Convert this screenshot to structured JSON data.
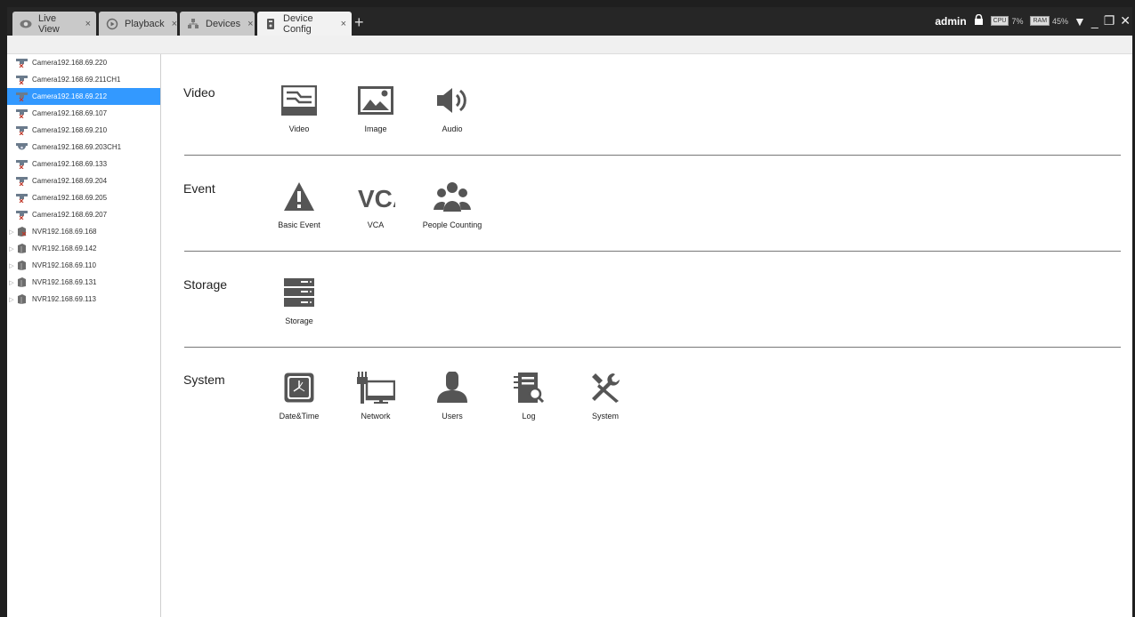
{
  "tabs": [
    {
      "label": "Live View",
      "icon": "eye-icon",
      "active": false
    },
    {
      "label": "Playback",
      "icon": "playback-icon",
      "active": false
    },
    {
      "label": "Devices",
      "icon": "devices-icon",
      "active": false
    },
    {
      "label": "Device Config",
      "icon": "device-config-icon",
      "active": true
    }
  ],
  "tab_close": "×",
  "new_tab": "+",
  "status": {
    "user": "admin",
    "cpu_label": "CPU",
    "cpu": "7%",
    "ram_label": "RAM",
    "ram": "45%"
  },
  "window": {
    "menu": "▼",
    "minimize": "_",
    "restore": "❐",
    "close": "✕"
  },
  "tree": [
    {
      "label": "Camera192.168.69.220",
      "type": "camera-x"
    },
    {
      "label": "Camera192.168.69.211CH1",
      "type": "camera-x"
    },
    {
      "label": "Camera192.168.69.212",
      "type": "camera-x",
      "selected": true
    },
    {
      "label": "Camera192.168.69.107",
      "type": "camera-x"
    },
    {
      "label": "Camera192.168.69.210",
      "type": "camera-x"
    },
    {
      "label": "Camera192.168.69.203CH1",
      "type": "camera"
    },
    {
      "label": "Camera192.168.69.133",
      "type": "camera-x"
    },
    {
      "label": "Camera192.168.69.204",
      "type": "camera-x"
    },
    {
      "label": "Camera192.168.69.205",
      "type": "camera-x"
    },
    {
      "label": "Camera192.168.69.207",
      "type": "camera-x"
    },
    {
      "label": "NVR192.168.69.168",
      "type": "nvr-x"
    },
    {
      "label": "NVR192.168.69.142",
      "type": "nvr"
    },
    {
      "label": "NVR192.168.69.110",
      "type": "nvr"
    },
    {
      "label": "NVR192.168.69.131",
      "type": "nvr"
    },
    {
      "label": "NVR192.168.69.113",
      "type": "nvr"
    }
  ],
  "sections": [
    {
      "title": "Video",
      "items": [
        {
          "label": "Video",
          "icon": "video-icon"
        },
        {
          "label": "Image",
          "icon": "image-icon"
        },
        {
          "label": "Audio",
          "icon": "audio-icon"
        }
      ]
    },
    {
      "title": "Event",
      "items": [
        {
          "label": "Basic Event",
          "icon": "warning-icon"
        },
        {
          "label": "VCA",
          "icon": "vca-icon"
        },
        {
          "label": "People Counting",
          "icon": "people-icon"
        }
      ]
    },
    {
      "title": "Storage",
      "items": [
        {
          "label": "Storage",
          "icon": "storage-icon"
        }
      ]
    },
    {
      "title": "System",
      "items": [
        {
          "label": "Date&Time",
          "icon": "clock-icon"
        },
        {
          "label": "Network",
          "icon": "network-icon"
        },
        {
          "label": "Users",
          "icon": "user-icon"
        },
        {
          "label": "Log",
          "icon": "log-icon"
        },
        {
          "label": "System",
          "icon": "tools-icon"
        }
      ]
    }
  ]
}
